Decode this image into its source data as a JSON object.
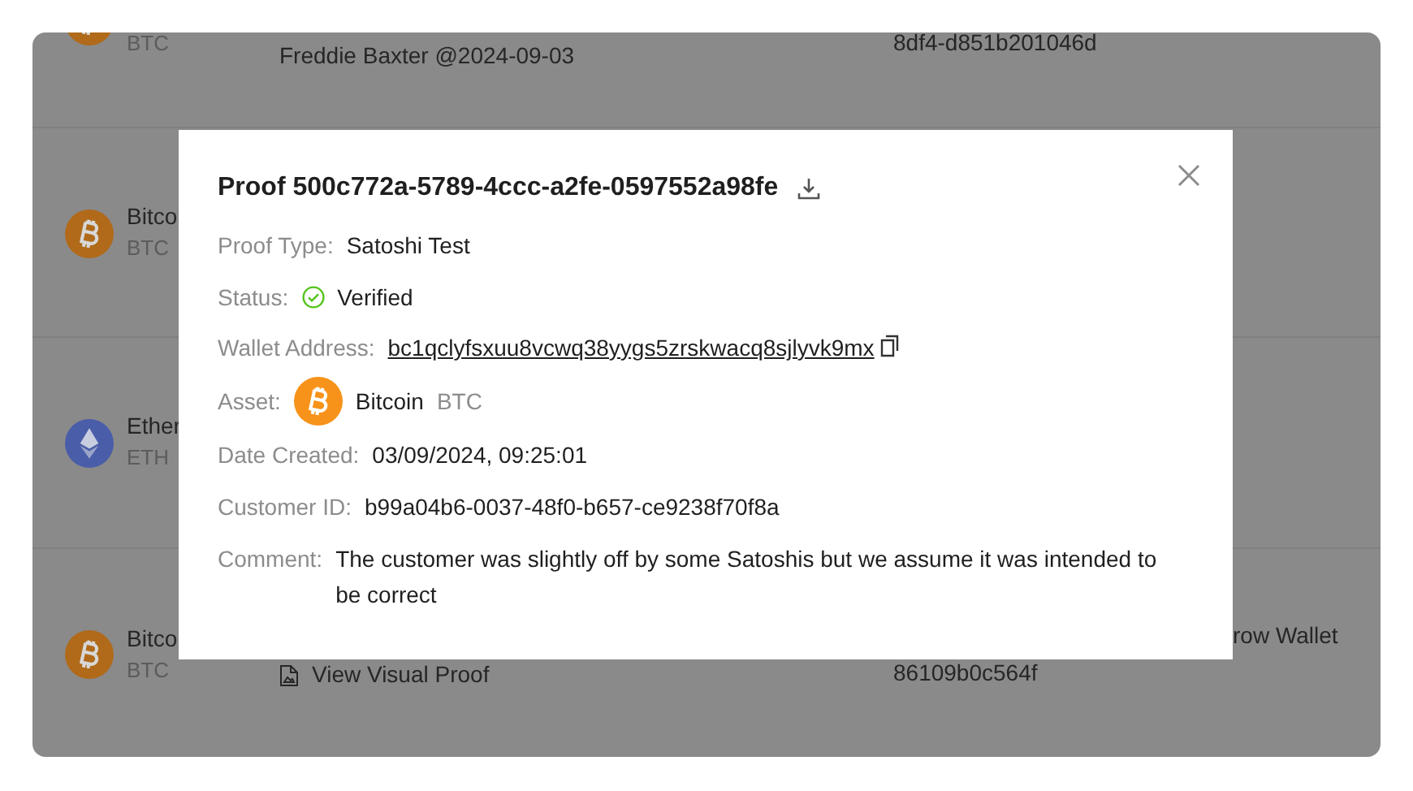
{
  "table": {
    "rows": [
      {
        "kind": "bitcoin",
        "symbol": "BTC",
        "column_2": "Freddie Baxter @2024-09-03",
        "column_3": "8df4-d851b201046d"
      },
      {
        "kind": "bitcoin",
        "name": "Bitco",
        "symbol": "BTC"
      },
      {
        "kind": "ethereum",
        "name": "Ether",
        "symbol": "ETH"
      },
      {
        "kind": "bitcoin",
        "name": "Bitco",
        "symbol": "BTC",
        "column_2": "View Visual Proof",
        "column_3_top": "row Wallet",
        "column_3": "86109b0c564f"
      }
    ]
  },
  "modal": {
    "title": "Proof 500c772a-5789-4ccc-a2fe-0597552a98fe",
    "fields": [
      {
        "kind": "text",
        "label": "Proof Type:",
        "value": "Satoshi Test"
      },
      {
        "kind": "status",
        "label": "Status:",
        "value": "Verified"
      },
      {
        "kind": "link",
        "label": "Wallet Address:",
        "value": "bc1qclyfsxuu8vcwq38yygs5zrskwacq8sjlyvk9mx"
      },
      {
        "kind": "asset",
        "label": "Asset:",
        "value": "Bitcoin",
        "symbol": "BTC"
      },
      {
        "kind": "text",
        "label": "Date Created:",
        "value": "03/09/2024, 09:25:01"
      },
      {
        "kind": "text",
        "label": "Customer ID:",
        "value": "b99a04b6-0037-48f0-b657-ce9238f70f8a"
      },
      {
        "kind": "text",
        "label": "Comment:",
        "value": "The customer was slightly off by some Satoshis but we assume it was intended to be correct"
      }
    ]
  }
}
